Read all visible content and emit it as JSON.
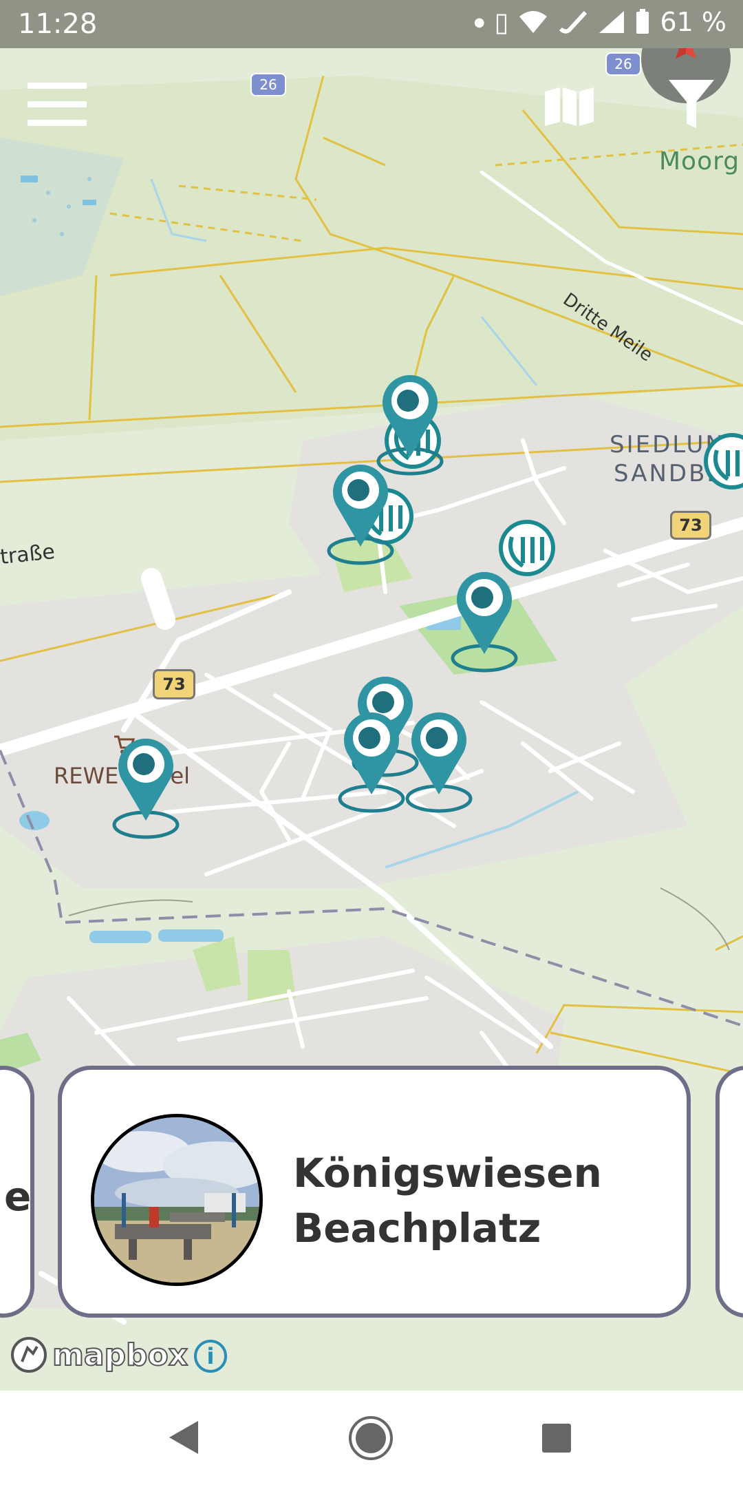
{
  "status_bar": {
    "time": "11:28",
    "battery": "61 %",
    "icons": [
      "notification-dot-icon",
      "vibrate-icon",
      "wifi-icon",
      "wifi-calling-icon",
      "signal-icon",
      "battery-icon"
    ]
  },
  "map": {
    "labels": {
      "moorgrund": "Moorg",
      "dritte_meile": "Dritte Meile",
      "siedlung_line1": "SIEDLUNG",
      "siedlung_line2": "SANDBEK",
      "strasse": "traße",
      "rewe": "REWE Fiebel"
    },
    "road_shields": {
      "b26_left": "26",
      "b26_right": "26",
      "b73_right": "73",
      "b73_left": "73"
    },
    "markers_color": "#1f8795",
    "cluster_icon": "cluster-logo-icon",
    "attribution": "mapbox"
  },
  "controls": {
    "menu_icon": "hamburger-menu-icon",
    "map_type_icon": "map-icon",
    "filter_icon": "filter-funnel-icon",
    "compass_icon": "compass-icon"
  },
  "card": {
    "title_line1": "Königswiesen",
    "title_line2": "Beachplatz",
    "left_fragment": "e"
  },
  "colors": {
    "accent": "#1f8795",
    "card_border": "#6f6e88",
    "road_yellow": "#e2c042",
    "shield_yellow": "#f2d478"
  }
}
